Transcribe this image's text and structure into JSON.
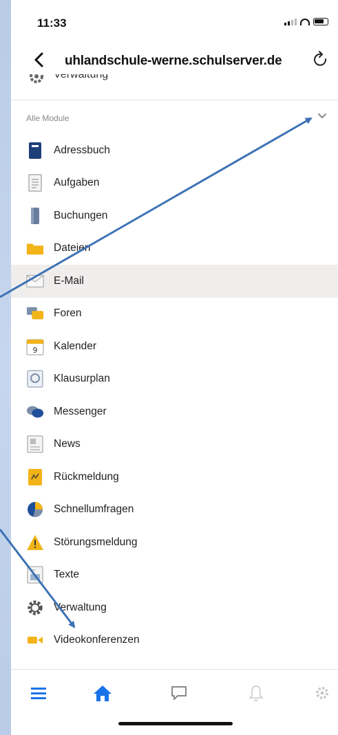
{
  "status": {
    "time": "11:33"
  },
  "browser": {
    "url": "uhlandschule-werne.schulserver.de"
  },
  "partial_item": {
    "label": "Verwaltung"
  },
  "section": {
    "label": "Alle Module"
  },
  "modules": [
    {
      "label": "Adressbuch",
      "icon": "address-book-icon"
    },
    {
      "label": "Aufgaben",
      "icon": "task-list-icon"
    },
    {
      "label": "Buchungen",
      "icon": "booking-icon"
    },
    {
      "label": "Dateien",
      "icon": "folder-icon"
    },
    {
      "label": "E-Mail",
      "icon": "envelope-icon"
    },
    {
      "label": "Foren",
      "icon": "forum-icon"
    },
    {
      "label": "Kalender",
      "icon": "calendar-icon"
    },
    {
      "label": "Klausurplan",
      "icon": "exam-plan-icon"
    },
    {
      "label": "Messenger",
      "icon": "chat-bubbles-icon"
    },
    {
      "label": "News",
      "icon": "newspaper-icon"
    },
    {
      "label": "Rückmeldung",
      "icon": "feedback-icon"
    },
    {
      "label": "Schnellumfragen",
      "icon": "pie-chart-icon"
    },
    {
      "label": "Störungsmeldung",
      "icon": "warning-icon"
    },
    {
      "label": "Texte",
      "icon": "text-document-icon"
    },
    {
      "label": "Verwaltung",
      "icon": "gear-icon"
    },
    {
      "label": "Videokonferenzen",
      "icon": "video-camera-icon"
    }
  ],
  "highlighted_module": "E-Mail",
  "tabbar": [
    {
      "name": "menu-icon",
      "active": true
    },
    {
      "name": "home-icon",
      "active": true
    },
    {
      "name": "chat-icon",
      "active": false
    },
    {
      "name": "bell-icon",
      "active": false
    },
    {
      "name": "settings-icon",
      "active": false
    }
  ],
  "colors": {
    "accent": "#1a73e8",
    "arrow": "#3d72b4",
    "background": "#c2d3ec",
    "highlight_row": "#f0eded"
  }
}
